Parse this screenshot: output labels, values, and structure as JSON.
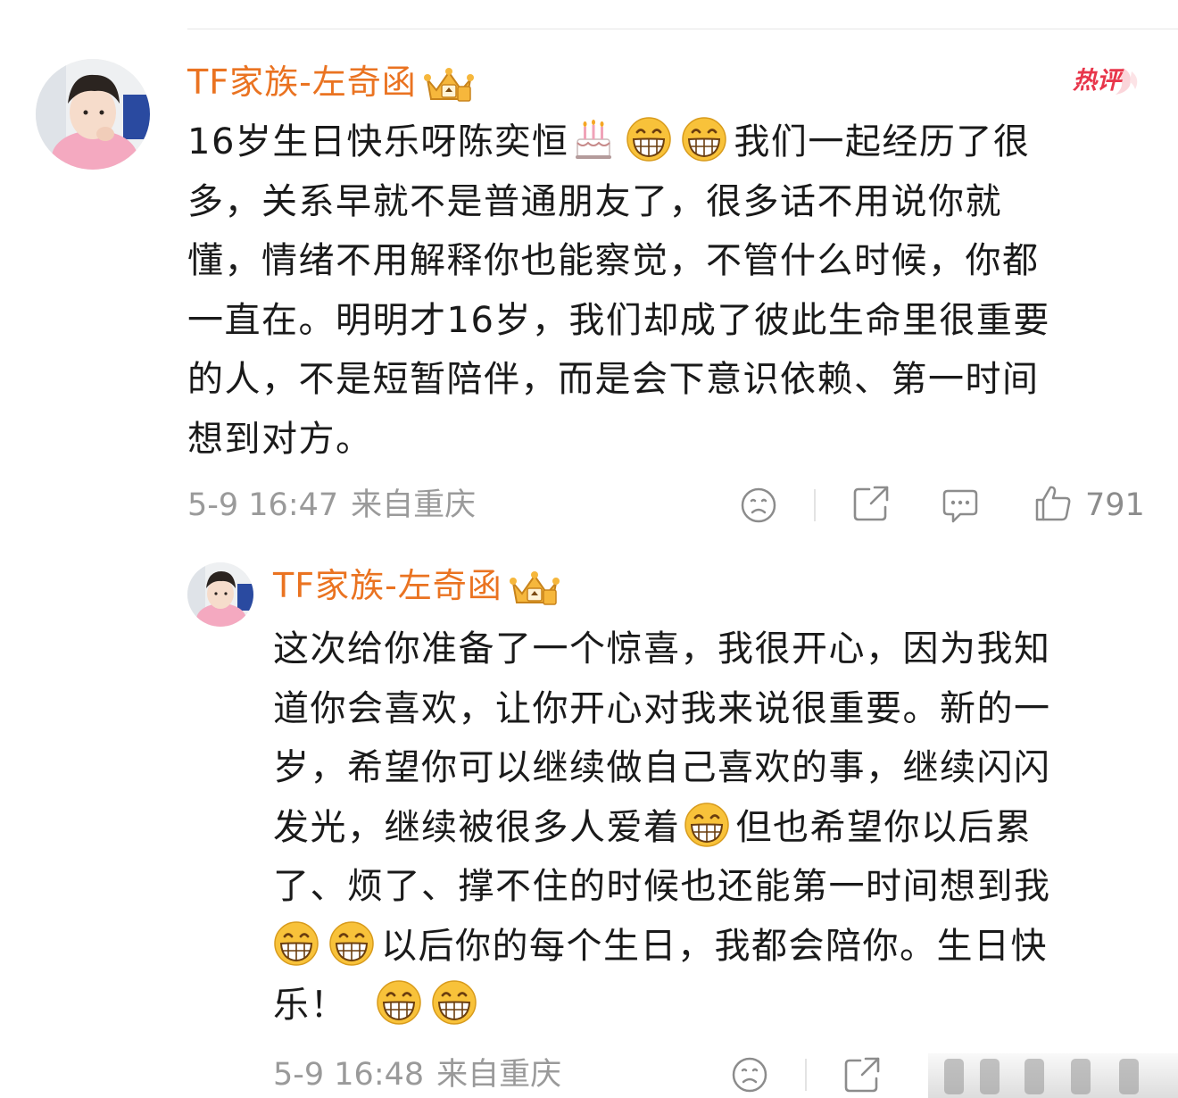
{
  "badge": {
    "hot_label": "热评"
  },
  "colors": {
    "username": "#ea7321",
    "hot_badge": "#e8364b",
    "meta": "#9a9a9a",
    "text": "#1a1a1a",
    "emoji_face": "#f8c23a"
  },
  "icons": {
    "sad": "sad-face-icon",
    "share": "share-icon",
    "comment": "comment-bubble-icon",
    "like": "thumbs-up-icon",
    "crown": "vip-crown-icon",
    "cake": "birthday-cake-emoji",
    "grin": "grinning-emoji"
  },
  "comments": [
    {
      "username": "TF家族-左奇函",
      "lines": [
        "16岁生日快乐呀陈奕恒",
        "我们一起经历了很",
        "多，关系早就不是普通朋友了，很多话不用说你就",
        "懂，情绪不用解释你也能察觉，不管什么时候，你都",
        "一直在。明明才16岁，我们却成了彼此生命里很重要",
        "的人，不是短暂陪伴，而是会下意识依赖、第一时间",
        "想到对方。"
      ],
      "time": "5-9 16:47",
      "location": "来自重庆",
      "likes": "791"
    },
    {
      "username": "TF家族-左奇函",
      "lines": [
        "这次给你准备了一个惊喜，我很开心，因为我知",
        "道你会喜欢，让你开心对我来说很重要。新的一",
        "岁，希望你可以继续做自己喜欢的事，继续闪闪",
        "发光，继续被很多人爱着",
        "但也希望你以后累",
        "了、烦了、撑不住的时候也还能第一时间想到我",
        "以后你的每个生日，我都会陪你。生日快",
        "乐！"
      ],
      "time": "5-9 16:48",
      "location": "来自重庆"
    }
  ]
}
